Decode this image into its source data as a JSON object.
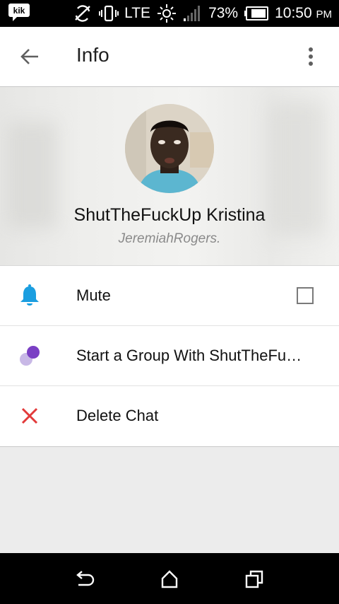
{
  "status_bar": {
    "app_logo": "kik",
    "network": "LTE",
    "battery": "73%",
    "time": "10:50",
    "ampm": "PM",
    "icons": [
      "kik-logo-icon",
      "no-sync-icon",
      "vibrate-icon",
      "brightness-icon",
      "signal-icon",
      "battery-icon"
    ]
  },
  "app_bar": {
    "title": "Info",
    "icons": [
      "back-arrow-icon",
      "more-vertical-icon"
    ]
  },
  "profile": {
    "display_name": "ShutTheFuckUp Kristina",
    "username": "JeremiahRogers."
  },
  "options": [
    {
      "label": "Mute",
      "icon": "bell-icon",
      "checked": false
    },
    {
      "label": "Start a Group With ShutTheFu…",
      "icon": "group-icon"
    },
    {
      "label": "Delete Chat",
      "icon": "close-icon"
    }
  ],
  "nav_bar": {
    "icons": [
      "nav-back-icon",
      "nav-home-icon",
      "nav-recents-icon"
    ]
  },
  "colors": {
    "accent_blue": "#1b9ee0",
    "group_purple": "#7a3fc4",
    "delete_red": "#e23a3a"
  }
}
